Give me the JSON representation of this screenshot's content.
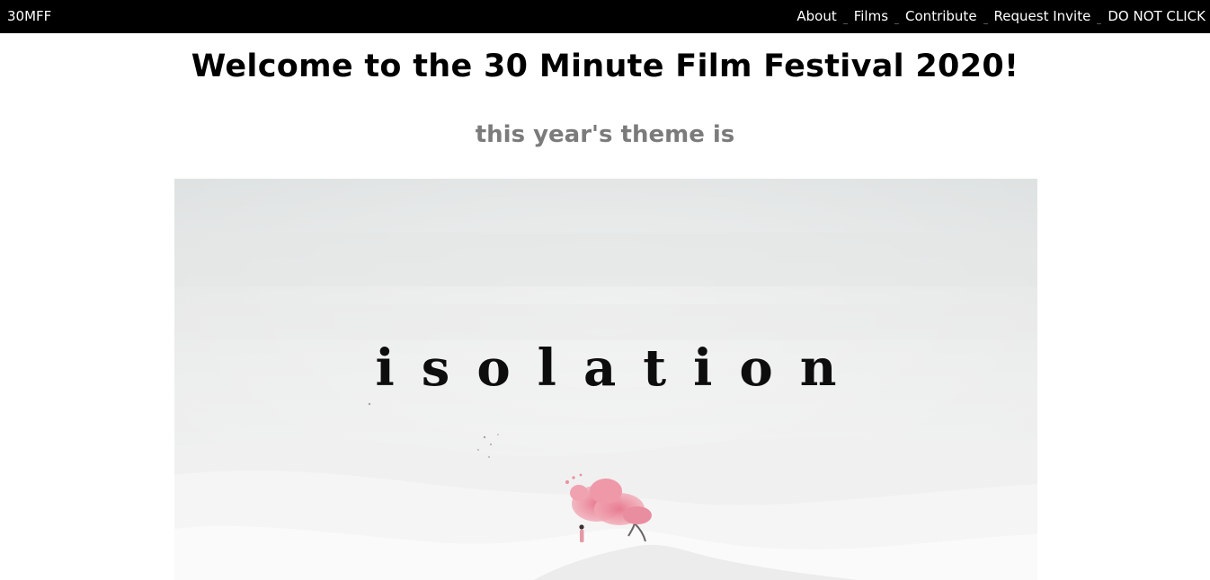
{
  "nav": {
    "brand": "30MFF",
    "links": [
      {
        "label": "About"
      },
      {
        "label": "Films"
      },
      {
        "label": "Contribute"
      },
      {
        "label": "Request Invite"
      },
      {
        "label": "DO NOT CLICK"
      }
    ]
  },
  "main": {
    "title": "Welcome to the 30 Minute Film Festival 2020!",
    "subtitle": "this year's theme is",
    "hero": {
      "theme_word": "isolation"
    }
  },
  "colors": {
    "navbar_bg": "#000000",
    "nav_text": "#ffffff",
    "title": "#000000",
    "subtitle": "#7b7b7b",
    "tree": "#e58a9a"
  }
}
